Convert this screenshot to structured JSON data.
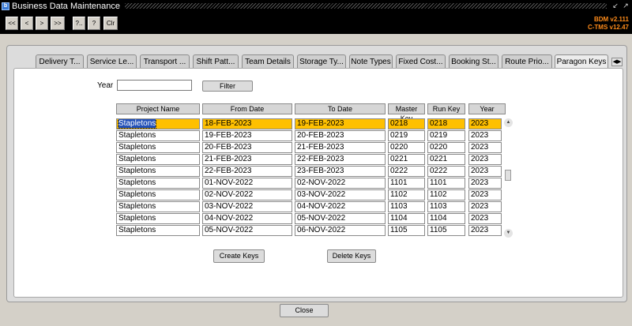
{
  "window": {
    "title": "Business Data Maintenance",
    "app_icon_text": "b"
  },
  "toolbar": {
    "buttons": [
      "<<",
      "<",
      ">",
      ">>",
      "?..",
      "?",
      "Clr"
    ],
    "version_bdm": "BDM v2.111",
    "version_ctms": "C-TMS v12.47"
  },
  "tabs": [
    "Delivery T...",
    "Service Le...",
    "Transport ...",
    "Shift Patt...",
    "Team Details",
    "Storage Ty...",
    "Note Types",
    "Fixed Cost...",
    "Booking St...",
    "Route Prio...",
    "Paragon Keys"
  ],
  "active_tab": "Paragon Keys",
  "filter": {
    "year_label": "Year",
    "year_value": "",
    "filter_button": "Filter"
  },
  "table": {
    "headers": [
      "Project Name",
      "From Date",
      "To Date",
      "Master Key",
      "Run Key",
      "Year"
    ],
    "rows": [
      [
        "Stapletons",
        "18-FEB-2023",
        "19-FEB-2023",
        "0218",
        "0218",
        "2023"
      ],
      [
        "Stapletons",
        "19-FEB-2023",
        "20-FEB-2023",
        "0219",
        "0219",
        "2023"
      ],
      [
        "Stapletons",
        "20-FEB-2023",
        "21-FEB-2023",
        "0220",
        "0220",
        "2023"
      ],
      [
        "Stapletons",
        "21-FEB-2023",
        "22-FEB-2023",
        "0221",
        "0221",
        "2023"
      ],
      [
        "Stapletons",
        "22-FEB-2023",
        "23-FEB-2023",
        "0222",
        "0222",
        "2023"
      ],
      [
        "Stapletons",
        "01-NOV-2022",
        "02-NOV-2022",
        "1101",
        "1101",
        "2023"
      ],
      [
        "Stapletons",
        "02-NOV-2022",
        "03-NOV-2022",
        "1102",
        "1102",
        "2023"
      ],
      [
        "Stapletons",
        "03-NOV-2022",
        "04-NOV-2022",
        "1103",
        "1103",
        "2023"
      ],
      [
        "Stapletons",
        "04-NOV-2022",
        "05-NOV-2022",
        "1104",
        "1104",
        "2023"
      ],
      [
        "Stapletons",
        "05-NOV-2022",
        "06-NOV-2022",
        "1105",
        "1105",
        "2023"
      ]
    ],
    "selected_row": 0,
    "selected_color": "#ffc000"
  },
  "actions": {
    "create_keys": "Create Keys",
    "delete_keys": "Delete Keys",
    "close": "Close"
  },
  "colors": {
    "version_text": "#ff8c1a",
    "selection_highlight": "#2250b8"
  }
}
